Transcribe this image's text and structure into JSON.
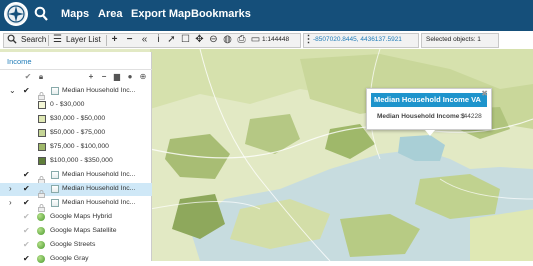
{
  "nav": {
    "items": [
      "Maps",
      "Area",
      "Export Map",
      "Bookmarks"
    ]
  },
  "toolbar": {
    "search_label": "Search",
    "layer_list_label": "Layer List",
    "coords": "-8507020.8445, 4436137.5921",
    "scale": "1:144448",
    "selected": "Selected objects: 1"
  },
  "panel": {
    "title": "Income",
    "rows": [
      {
        "label": "Median Household Inc...",
        "type": "layer",
        "checked": true,
        "caret": "down"
      },
      {
        "label": "0 - $30,000",
        "type": "legend",
        "color": "#f4f7d6"
      },
      {
        "label": "$30,000 - $50,000",
        "type": "legend",
        "color": "#dfe8b4"
      },
      {
        "label": "$50,000 - $75,000",
        "type": "legend",
        "color": "#c5d596"
      },
      {
        "label": "$75,000 - $100,000",
        "type": "legend",
        "color": "#9fb86a"
      },
      {
        "label": "$100,000 - $350,000",
        "type": "legend",
        "color": "#5f7e3a"
      },
      {
        "label": "Median Household Inc...",
        "type": "layer",
        "checked": true,
        "caret": "none"
      },
      {
        "label": "Median Household Inc...",
        "type": "layer",
        "checked": true,
        "caret": "right",
        "selected": true
      },
      {
        "label": "Median Household Inc...",
        "type": "layer",
        "checked": true,
        "caret": "right"
      },
      {
        "label": "Google Maps Hybrid",
        "type": "base",
        "checked": false
      },
      {
        "label": "Google Maps Satellite",
        "type": "base",
        "checked": false
      },
      {
        "label": "Google Streets",
        "type": "base",
        "checked": false
      },
      {
        "label": "Google Gray",
        "type": "base",
        "checked": true
      }
    ]
  },
  "popup": {
    "title": "Median Household Income VA",
    "field": "Median Household Income $",
    "value": ": 44228"
  },
  "colors": {
    "nav_bg": "#154f7a",
    "popup_title_bg": "#1e94cc",
    "selected_row": "#cfe8f7"
  }
}
